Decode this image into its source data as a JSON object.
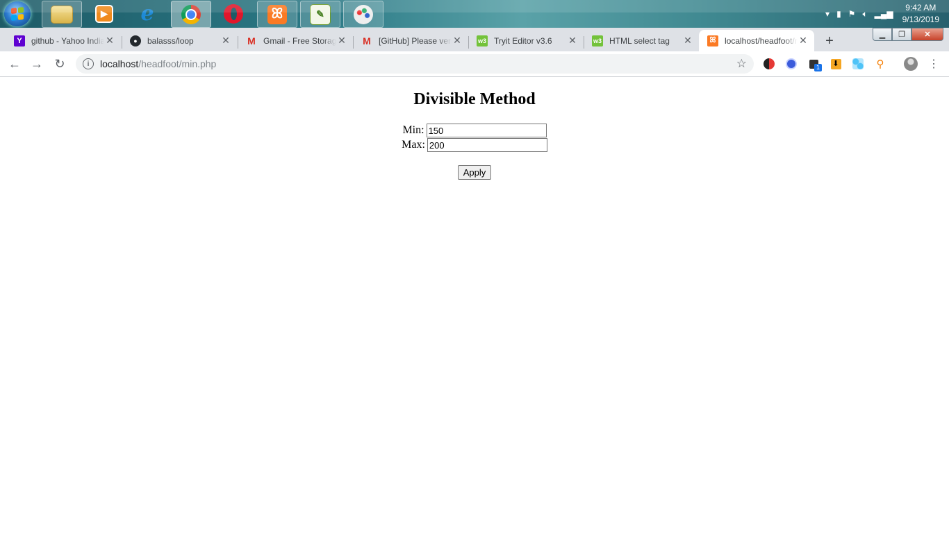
{
  "taskbar": {
    "apps": [
      {
        "name": "file-explorer"
      },
      {
        "name": "media-player"
      },
      {
        "name": "internet-explorer"
      },
      {
        "name": "chrome"
      },
      {
        "name": "opera"
      },
      {
        "name": "xampp"
      },
      {
        "name": "notepad-plus"
      },
      {
        "name": "paint"
      }
    ],
    "clock": {
      "time": "9:42 AM",
      "date": "9/13/2019"
    }
  },
  "browser": {
    "tabs": [
      {
        "title": "github - Yahoo India Search Results",
        "favicon": "Y",
        "favicon_color": "#5f01d1"
      },
      {
        "title": "balasss/loop",
        "favicon": "gh",
        "favicon_color": "#000000"
      },
      {
        "title": "Gmail - Free Storage and Email from Google",
        "favicon": "M",
        "favicon_color": "#d93025"
      },
      {
        "title": "[GitHub] Please verify your email address",
        "favicon": "M",
        "favicon_color": "#d93025"
      },
      {
        "title": "Tryit Editor v3.6",
        "favicon": "w3",
        "favicon_color": "#73c23a"
      },
      {
        "title": "HTML select tag",
        "favicon": "w3",
        "favicon_color": "#73c23a"
      },
      {
        "title": "localhost/headfoot/min.php",
        "favicon": "xampp",
        "favicon_color": "#fb7a24"
      }
    ],
    "active_tab": 6,
    "address": {
      "host": "localhost",
      "path": "/headfoot/min.php"
    },
    "extension_badge": "1"
  },
  "page": {
    "heading": "Divisible Method",
    "min_label": "Min:",
    "min_value": "150",
    "max_label": "Max:",
    "max_value": "200",
    "apply_label": "Apply"
  }
}
